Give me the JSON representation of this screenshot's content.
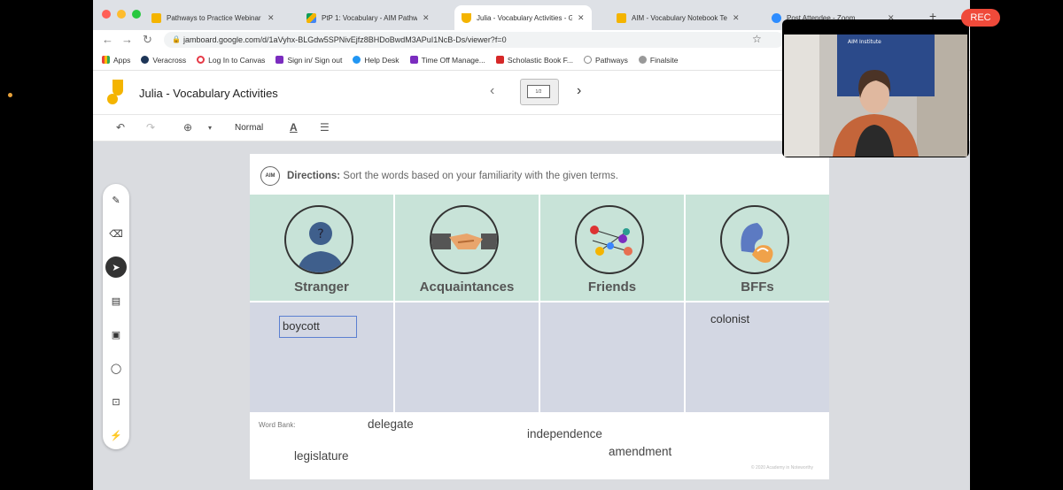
{
  "colors": {
    "accent_blue": "#5b7fd1",
    "column_header_green": "#c8e3d8",
    "column_body_grey": "#d3d7e3",
    "rec_red": "#ef4a3a",
    "jamboard_yellow": "#f4b400"
  },
  "tabs": [
    {
      "label": "Pathways to Practice Webinar",
      "icon": "slides-icon",
      "active": false
    },
    {
      "label": "PtP 1: Vocabulary - AIM Pathw",
      "icon": "drive-icon",
      "active": false
    },
    {
      "label": "Julia - Vocabulary Activities - G",
      "icon": "jamboard-icon",
      "active": true
    },
    {
      "label": "AIM - Vocabulary Notebook Te",
      "icon": "slides-icon",
      "active": false
    },
    {
      "label": "Post Attendee - Zoom",
      "icon": "zoom-icon",
      "active": false
    }
  ],
  "address": {
    "url": "jamboard.google.com/d/1aVyhx-BLGdw5SPNivEjfz8BHDoBwdM3APuI1NcB-Ds/viewer?f=0"
  },
  "bookmarks": [
    "Apps",
    "Veracross",
    "Log In to Canvas",
    "Sign in/ Sign out",
    "Help Desk",
    "Time Off Manage...",
    "Scholastic Book F...",
    "Pathways",
    "Finalsite"
  ],
  "jamboard": {
    "title": "Julia - Vocabulary Activities",
    "frame_label": "1/2",
    "toolbar": {
      "font_size": "Normal",
      "text_color_glyph": "A"
    }
  },
  "board": {
    "directions_label": "Directions:",
    "directions_text": "Sort the words based on your familiarity with the given terms.",
    "logo_text": "AIM",
    "columns": [
      {
        "label": "Stranger",
        "icon": "stranger-silhouette-icon"
      },
      {
        "label": "Acquaintances",
        "icon": "handshake-icon"
      },
      {
        "label": "Friends",
        "icon": "friends-network-icon"
      },
      {
        "label": "BFFs",
        "icon": "bff-hearts-icon"
      }
    ],
    "sorted_words": {
      "stranger": "boycott",
      "bffs": "colonist"
    },
    "word_bank_label": "Word Bank:",
    "word_bank": {
      "delegate": "delegate",
      "independence": "independence",
      "legislature": "legislature",
      "amendment": "amendment"
    },
    "copyright": "© 2020 Academy in Noteworthy"
  },
  "zoom": {
    "rec_label": "REC",
    "banner_text": "AIM Institute"
  }
}
